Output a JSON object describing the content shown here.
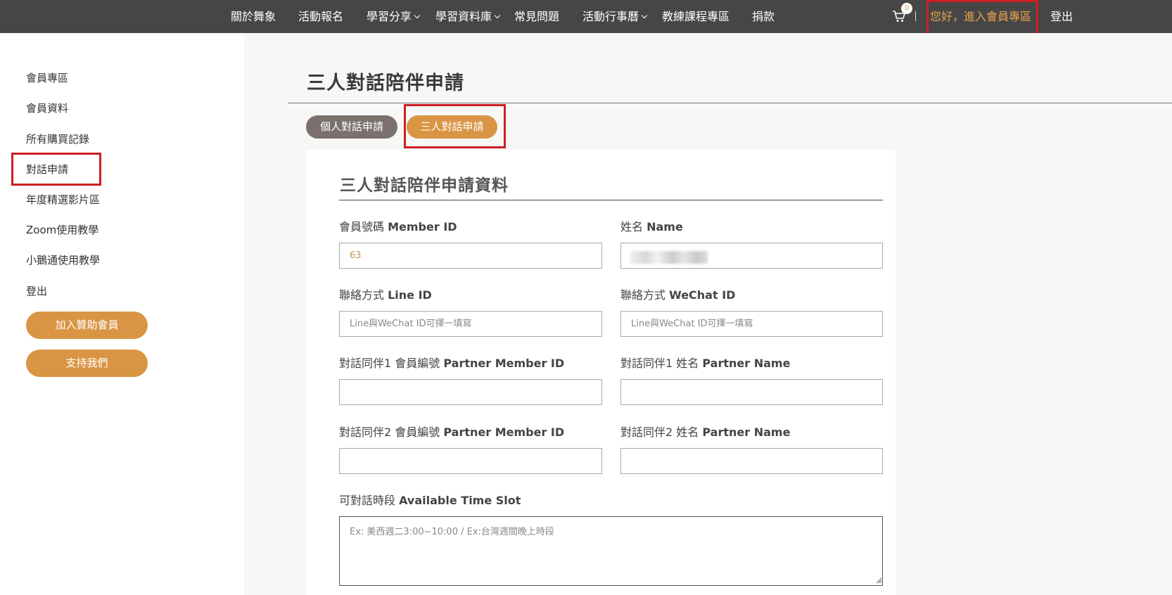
{
  "nav": {
    "items": [
      "關於舞象",
      "活動報名",
      "學習分享",
      "學習資料庫",
      "常見問題",
      "活動行事曆",
      "教練課程專區",
      "捐款"
    ],
    "cart_count": "0",
    "greeting": "您好，進入會員專區",
    "logout": "登出"
  },
  "sidebar": {
    "items": [
      "會員專區",
      "會員資料",
      "所有購買記錄",
      "對話申請",
      "年度精選影片區",
      "Zoom使用教學",
      "小鵝通使用教學",
      "登出"
    ],
    "buttons": [
      "加入贊助會員",
      "支持我們"
    ]
  },
  "main": {
    "title": "三人對話陪伴申請",
    "tabs": [
      "個人對話申請",
      "三人對話申請"
    ],
    "form_title": "三人對話陪伴申請資料",
    "fields": {
      "member_id": {
        "label_zh": "會員號碼",
        "label_en": "Member ID",
        "value": "63"
      },
      "name": {
        "label_zh": "姓名",
        "label_en": "Name",
        "value": ""
      },
      "line_id": {
        "label_zh": "聯絡方式",
        "label_en": "Line ID",
        "placeholder": "Line與WeChat ID可擇一填寫"
      },
      "wechat_id": {
        "label_zh": "聯絡方式",
        "label_en": "WeChat ID",
        "placeholder": "Line與WeChat ID可擇一填寫"
      },
      "partner1_id": {
        "label_zh": "對話同伴1 會員編號",
        "label_en": "Partner Member ID"
      },
      "partner1_name": {
        "label_zh": "對話同伴1 姓名",
        "label_en": "Partner Name"
      },
      "partner2_id": {
        "label_zh": "對話同伴2 會員編號",
        "label_en": "Partner Member ID"
      },
      "partner2_name": {
        "label_zh": "對話同伴2 姓名",
        "label_en": "Partner Name"
      },
      "time_slot": {
        "label_zh": "可對話時段",
        "label_en": "Available Time Slot",
        "placeholder": "Ex: 美西週二3:00~10:00 / Ex:台灣週間晚上時段"
      }
    }
  },
  "colors": {
    "topbar": "#464646",
    "accent": "#d99544",
    "highlight_box": "#cc1f24",
    "tab_inactive": "#7a716c"
  }
}
